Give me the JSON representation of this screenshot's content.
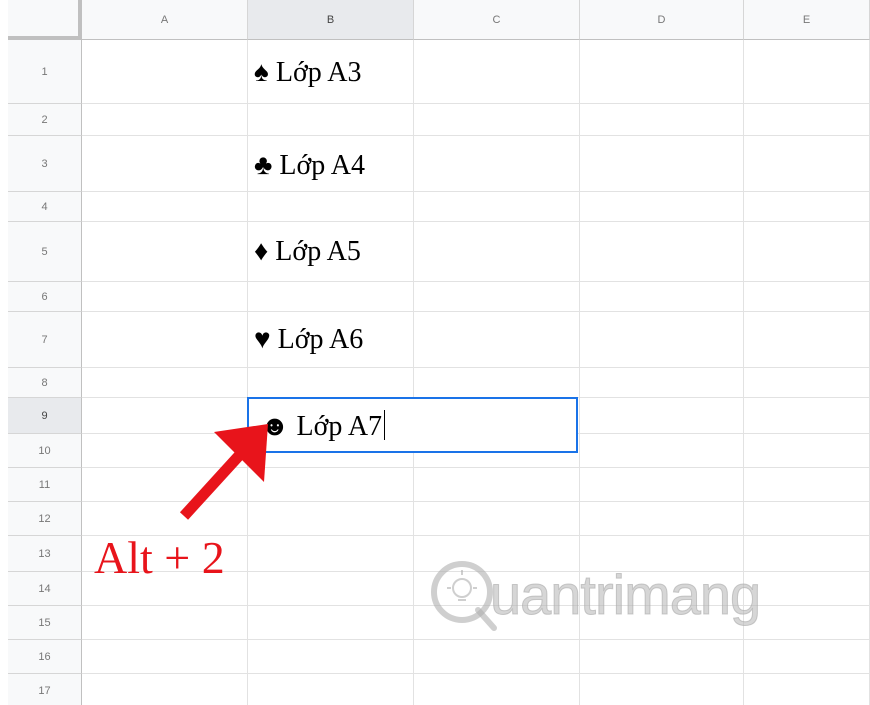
{
  "columns": [
    "A",
    "B",
    "C",
    "D",
    "E"
  ],
  "rows": [
    "1",
    "2",
    "3",
    "4",
    "5",
    "6",
    "7",
    "8",
    "9",
    "10",
    "11",
    "12",
    "13",
    "14",
    "15",
    "16",
    "17"
  ],
  "selected_column": "B",
  "selected_row": "9",
  "cells": {
    "B1": "♠ Lớp A3",
    "B3": "♣ Lớp A4",
    "B5": "♦ Lớp A5",
    "B7": "♥ Lớp A6"
  },
  "active_cell": {
    "ref": "B9",
    "value": "☻ Lớp A7"
  },
  "annotation": {
    "label": "Alt + 2",
    "color": "#e8141b"
  },
  "watermark": {
    "text": "uantrimang",
    "icon": "lightbulb-q-icon"
  },
  "colors": {
    "selection_border": "#1a73e8",
    "header_bg": "#f8f9fa",
    "header_selected_bg": "#e8eaed"
  }
}
